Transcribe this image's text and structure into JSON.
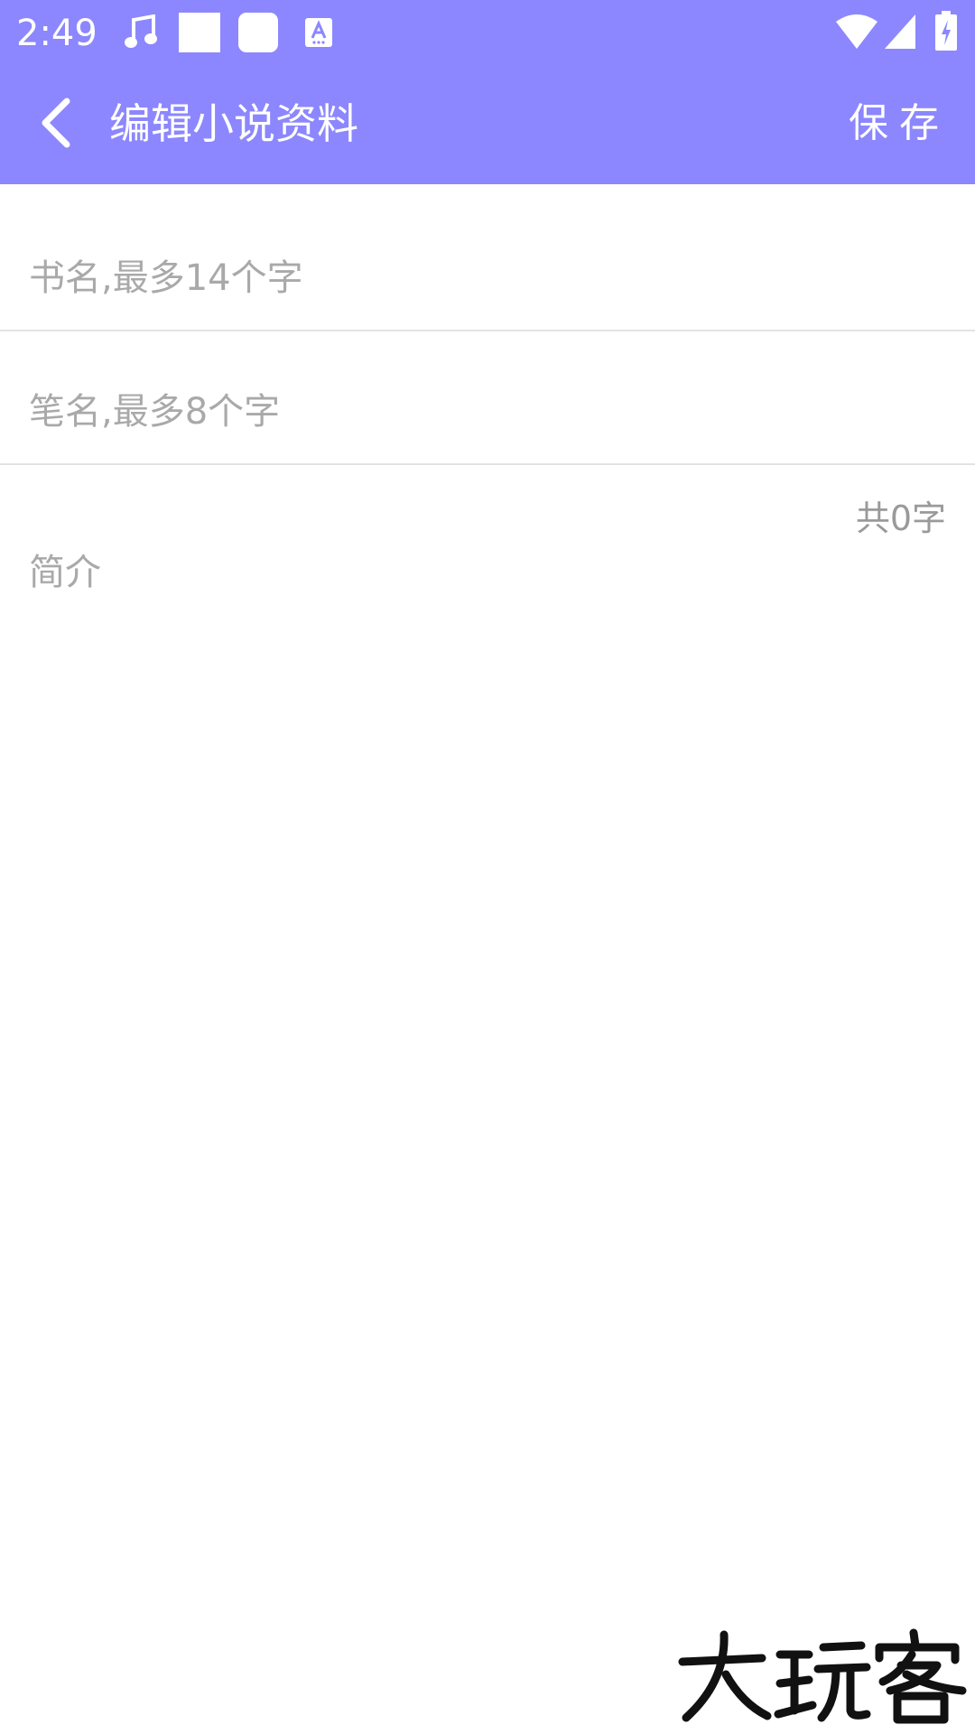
{
  "status_bar": {
    "time": "2:49",
    "icons": [
      "music-note-icon",
      "square-icon",
      "rounded-square-icon",
      "keyboard-a-icon",
      "wifi-icon",
      "cell-signal-icon",
      "battery-charging-icon"
    ]
  },
  "app_bar": {
    "title": "编辑小说资料",
    "save_label": "保存",
    "background": "#8c87fe"
  },
  "form": {
    "book_title_placeholder": "书名,最多14个字",
    "pen_name_placeholder": "笔名,最多8个字",
    "char_count": "共0字",
    "intro_placeholder": "简介"
  },
  "watermark": {
    "text": "大玩客"
  }
}
